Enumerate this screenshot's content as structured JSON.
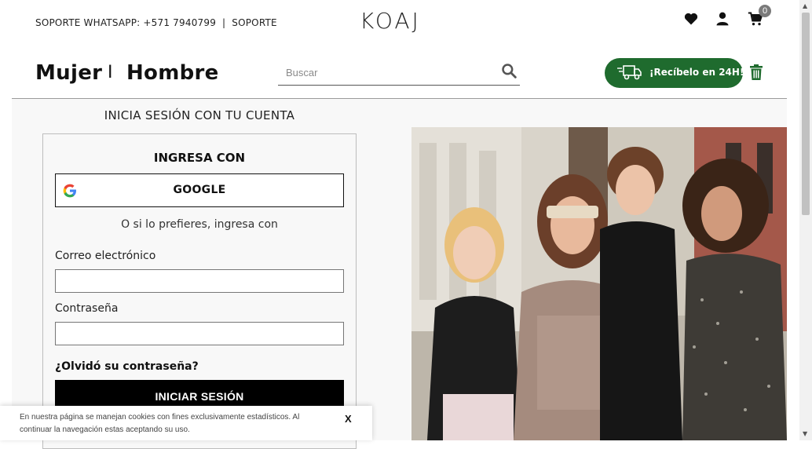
{
  "header": {
    "support_whatsapp": "SOPORTE WHATSAPP: +571 7940799",
    "separator": "|",
    "support_link": "SOPORTE",
    "logo": "KOAJ",
    "cart_count": "0"
  },
  "nav": {
    "mujer": "Mujer",
    "separator": "I",
    "hombre": "Hombre",
    "search_placeholder": "Buscar",
    "delivery_label": "¡Recíbelo en 24H!"
  },
  "login": {
    "page_title": "INICIA SESIÓN CON TU CUENTA",
    "ingresa_con": "INGRESA CON",
    "google_label": "GOOGLE",
    "alt_text": "O si lo prefieres, ingresa con",
    "email_label": "Correo electrónico",
    "email_value": "",
    "password_label": "Contraseña",
    "password_value": "",
    "forgot_label": "¿Olvidó su contraseña?",
    "submit_label": "INICIAR SESIÓN"
  },
  "cookie": {
    "text": "En nuestra página se manejan cookies con fines exclusivamente estadísticos. Al continuar la navegación estas aceptando su uso.",
    "close_label": "X"
  },
  "icons": {
    "wishlist": "heart-icon",
    "account": "user-icon",
    "cart": "cart-icon",
    "search": "search-icon",
    "delivery": "truck-icon",
    "trash": "trash-icon",
    "google": "google-icon"
  },
  "colors": {
    "delivery_green": "#1f6b2e",
    "button_black": "#000000"
  }
}
